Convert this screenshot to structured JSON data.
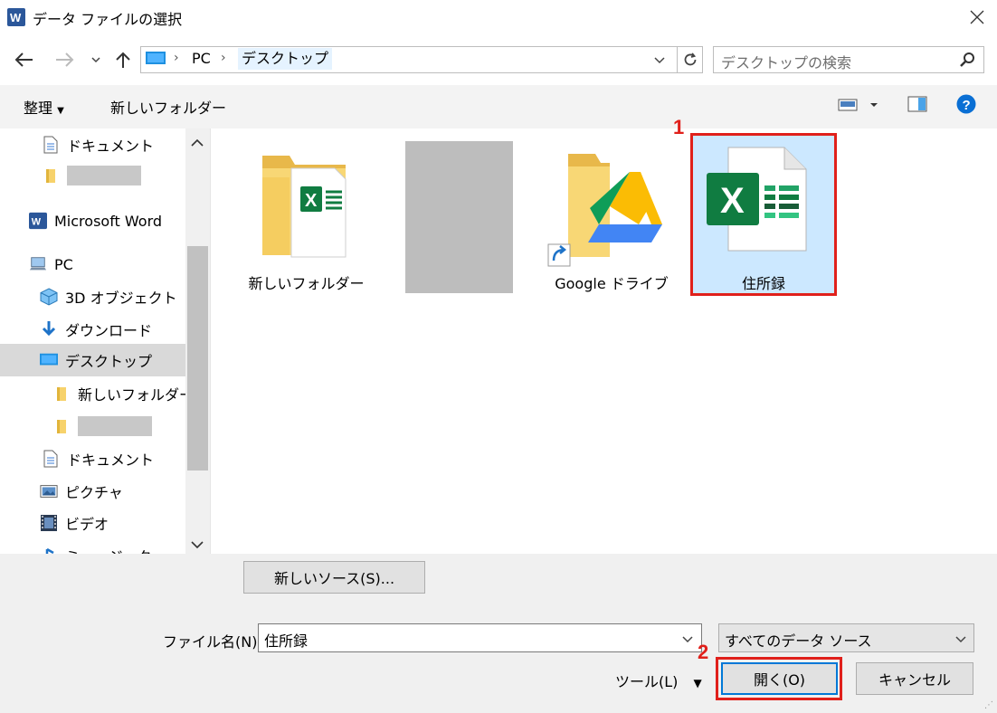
{
  "window": {
    "title": "データ ファイルの選択"
  },
  "nav": {
    "path": [
      "PC",
      "デスクトップ"
    ],
    "search_placeholder": "デスクトップの検索"
  },
  "commands": {
    "organize": "整理",
    "new_folder": "新しいフォルダー"
  },
  "sidebar": {
    "items": [
      {
        "label": "ドキュメント",
        "icon": "document-icon"
      },
      {
        "label": "",
        "icon": "folder-icon",
        "redacted": true
      },
      {
        "label": "Microsoft Word",
        "icon": "word-icon"
      },
      {
        "label": "PC",
        "icon": "pc-icon"
      },
      {
        "label": "3D オブジェクト",
        "icon": "3d-objects-icon"
      },
      {
        "label": "ダウンロード",
        "icon": "download-icon"
      },
      {
        "label": "デスクトップ",
        "icon": "desktop-icon",
        "selected": true
      },
      {
        "label": "新しいフォルダー",
        "icon": "folder-icon"
      },
      {
        "label": "",
        "icon": "folder-icon",
        "redacted": true
      },
      {
        "label": "ドキュメント",
        "icon": "document-icon"
      },
      {
        "label": "ピクチャ",
        "icon": "pictures-icon"
      },
      {
        "label": "ビデオ",
        "icon": "video-icon"
      },
      {
        "label": "ミュージック",
        "icon": "music-icon"
      }
    ]
  },
  "files": [
    {
      "label": "新しいフォルダー",
      "icon": "folder-with-excel-icon"
    },
    {
      "label": "",
      "icon": "redacted-thumbnail",
      "redacted": true
    },
    {
      "label": "Google ドライブ",
      "icon": "google-drive-folder-icon"
    },
    {
      "label": "住所録",
      "icon": "excel-file-icon",
      "selected": true
    }
  ],
  "bottom": {
    "new_source": "新しいソース(S)...",
    "filename_label": "ファイル名(N):",
    "filename_value": "住所録",
    "filetype_value": "すべてのデータ ソース",
    "tools": "ツール(L)",
    "open": "開く(O)",
    "cancel": "キャンセル"
  },
  "annotations": {
    "step1": "1",
    "step2": "2"
  },
  "colors": {
    "accent": "#0078d7",
    "highlight": "#cce8ff",
    "annotation": "#e0201b",
    "excel": "#107c41"
  }
}
